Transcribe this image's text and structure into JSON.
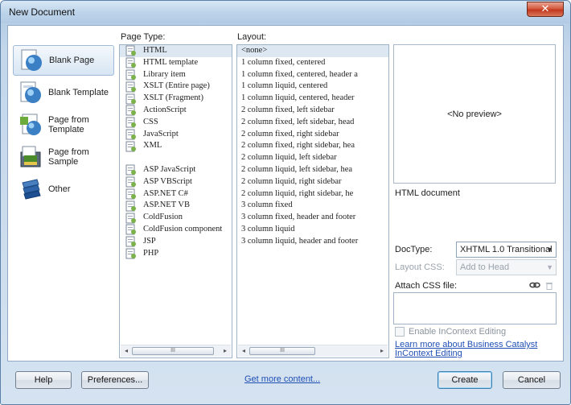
{
  "window": {
    "title": "New Document",
    "close_glyph": "✕"
  },
  "categories": [
    {
      "label": "Blank Page",
      "icon": "blank-page-icon",
      "selected": true
    },
    {
      "label": "Blank Template",
      "icon": "blank-template-icon",
      "selected": false
    },
    {
      "label": "Page from Template",
      "icon": "page-from-template-icon",
      "selected": false
    },
    {
      "label": "Page from Sample",
      "icon": "page-from-sample-icon",
      "selected": false
    },
    {
      "label": "Other",
      "icon": "other-icon",
      "selected": false
    }
  ],
  "page_type": {
    "label": "Page Type:",
    "selected": "HTML",
    "items": [
      "HTML",
      "HTML template",
      "Library item",
      "XSLT (Entire page)",
      "XSLT (Fragment)",
      "ActionScript",
      "CSS",
      "JavaScript",
      "XML",
      "",
      "ASP JavaScript",
      "ASP VBScript",
      "ASP.NET C#",
      "ASP.NET VB",
      "ColdFusion",
      "ColdFusion component",
      "JSP",
      "PHP"
    ]
  },
  "layout": {
    "label": "Layout:",
    "selected": "<none>",
    "items": [
      "<none>",
      "1 column fixed, centered",
      "1 column fixed, centered, header a",
      "1 column liquid, centered",
      "1 column liquid, centered, header",
      "2 column fixed, left sidebar",
      "2 column fixed, left sidebar, head",
      "2 column fixed, right sidebar",
      "2 column fixed, right sidebar, hea",
      "2 column liquid, left sidebar",
      "2 column liquid, left sidebar, hea",
      "2 column liquid, right sidebar",
      "2 column liquid, right sidebar, he",
      "3 column fixed",
      "3 column fixed, header and footer",
      "3 column liquid",
      "3 column liquid, header and footer"
    ]
  },
  "scrollbar": {
    "left_arrow": "◂",
    "right_arrow": "▸",
    "grip": "III"
  },
  "preview": {
    "text": "<No preview>",
    "description": "HTML document"
  },
  "doctype": {
    "label": "DocType:",
    "value": "XHTML 1.0 Transitional",
    "arrow": "▼"
  },
  "layout_css": {
    "label": "Layout CSS:",
    "value": "Add to Head",
    "arrow": "▼",
    "disabled": true
  },
  "attach_css": {
    "label": "Attach CSS file:",
    "link_icon": "chain-link-icon",
    "trash_icon": "trash-icon"
  },
  "incontext": {
    "label": "Enable InContext Editing",
    "checked": false,
    "disabled": true
  },
  "learn_more": "Learn more about Business Catalyst InContext Editing",
  "footer": {
    "help": "Help",
    "preferences": "Preferences...",
    "get_more": "Get more content...",
    "create": "Create",
    "cancel": "Cancel"
  }
}
